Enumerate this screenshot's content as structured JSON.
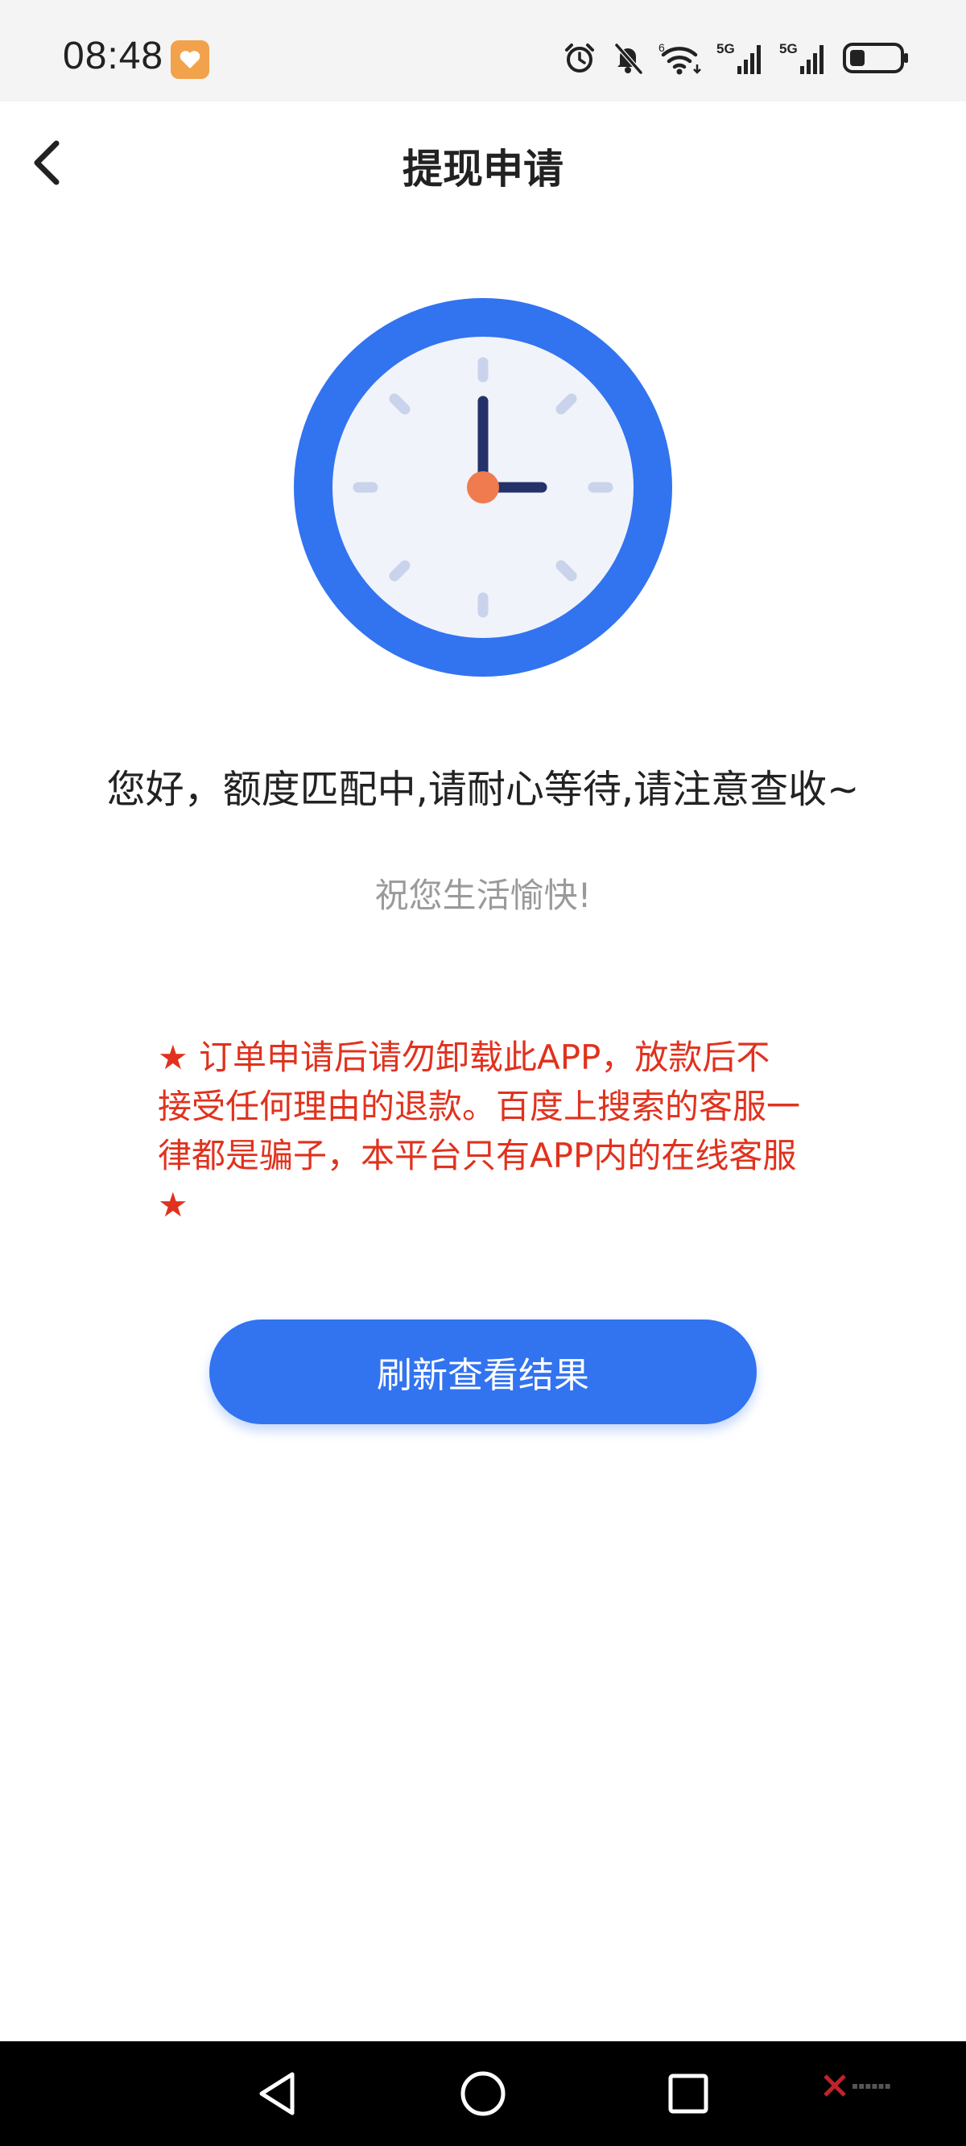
{
  "status_bar": {
    "time": "08:48",
    "icons": [
      "alarm-icon",
      "mute-icon",
      "wifi-icon",
      "signal-5g-icon",
      "signal-5g-icon",
      "battery-icon"
    ],
    "network_1": "5G",
    "network_2": "5G",
    "wifi_badge": "6"
  },
  "nav": {
    "title": "提现申请",
    "back_icon": "chevron-left-icon"
  },
  "clock": {
    "ring_color": "#3273f0",
    "face_color": "#f0f3fa",
    "hand_color": "#25326a",
    "center_color": "#ef7b4e"
  },
  "main": {
    "message": "您好，额度匹配中,请耐心等待,请注意查收~",
    "wish": "祝您生活愉快!",
    "warning": "★ 订单申请后请勿卸载此APP，放款后不接受任何理由的退款。百度上搜索的客服一律都是骗子，本平台只有APP内的在线客服★",
    "refresh_label": "刷新查看结果"
  },
  "system_nav": {
    "icons": [
      "back-triangle-icon",
      "home-circle-icon",
      "recents-square-icon"
    ]
  },
  "colors": {
    "accent": "#3273f0",
    "warning": "#e0321e",
    "muted": "#9a9a9a"
  }
}
